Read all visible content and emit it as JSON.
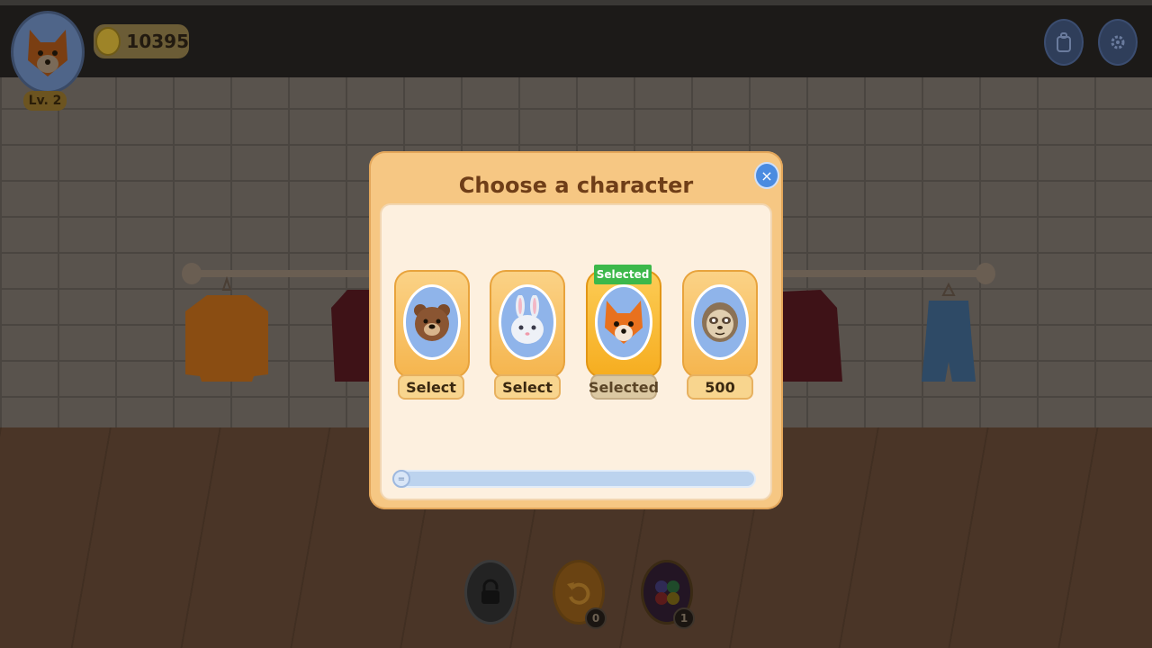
{
  "hud": {
    "level": "Lv. 2",
    "coins": "10395",
    "icons": [
      "fox-avatar-icon",
      "coin-icon",
      "backpack-icon",
      "settings-icon"
    ]
  },
  "dialog": {
    "title": "Choose a character",
    "close_symbol": "×",
    "selected_tag": "Selected",
    "characters": [
      {
        "animal": "bear",
        "button": "Select"
      },
      {
        "animal": "rabbit",
        "button": "Select"
      },
      {
        "animal": "fox",
        "button": "Selected"
      },
      {
        "animal": "sloth",
        "button": "500"
      }
    ],
    "scroll_symbol": "="
  },
  "bottom": {
    "undo_count": "0",
    "booster_count": "1",
    "icons": [
      "lock-icon",
      "undo-icon",
      "booster-icon"
    ]
  },
  "colors": {
    "accent_orange": "#f5b54e",
    "title_brown": "#6f3e18",
    "selected_green": "#3cb84a",
    "close_blue": "#4a8be0"
  }
}
